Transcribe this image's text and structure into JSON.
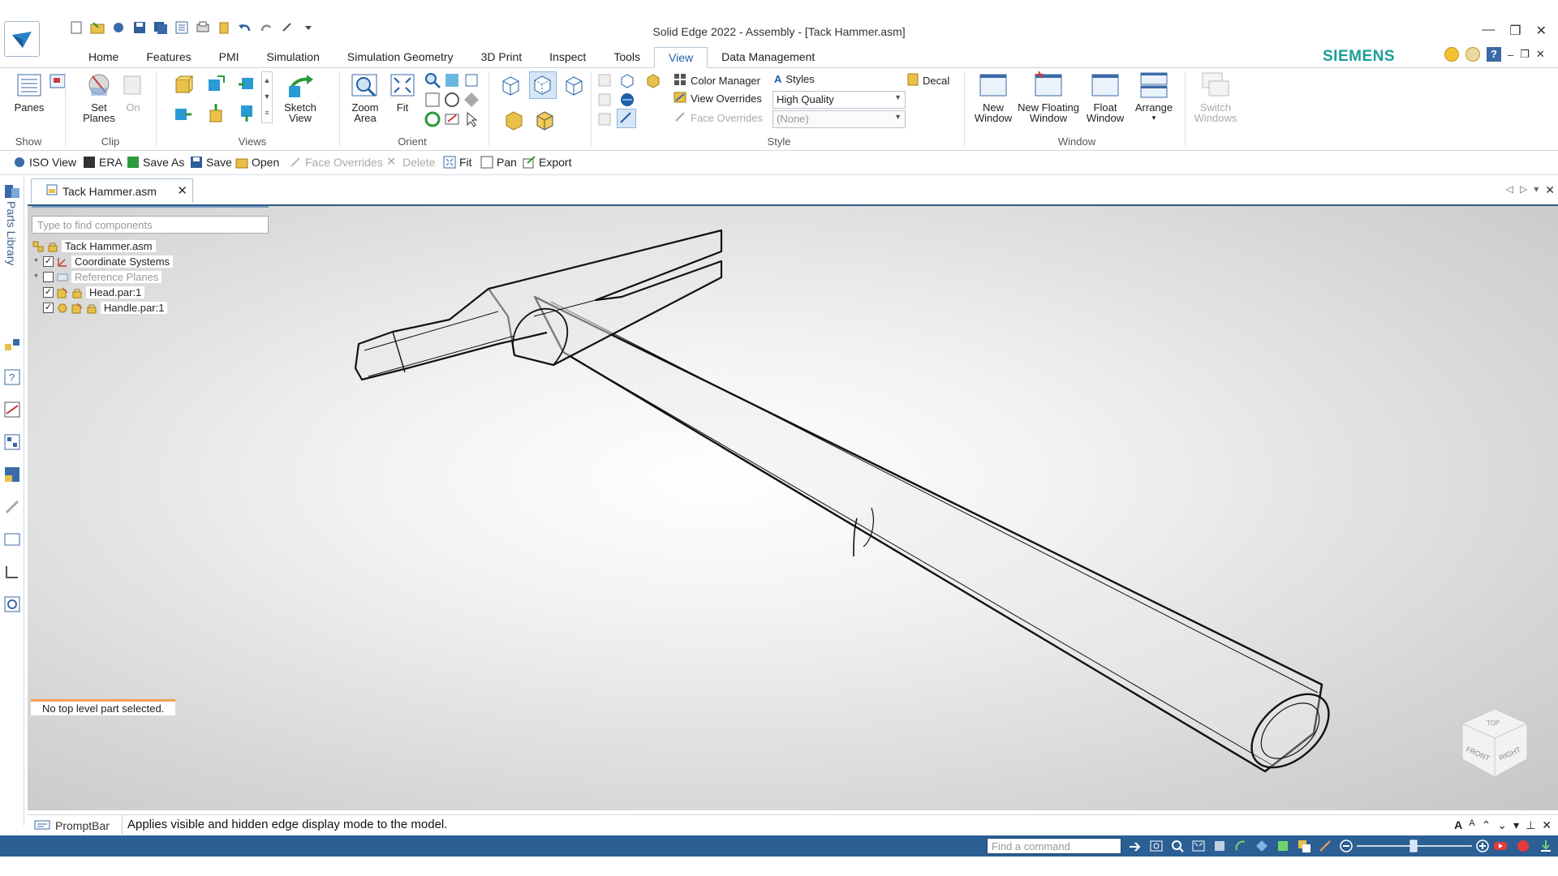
{
  "window": {
    "title": "Solid Edge 2022 - Assembly - [Tack Hammer.asm]",
    "brand": "SIEMENS",
    "brand_color": "#1a9e9a",
    "accent_color": "#2c5f94"
  },
  "tabs": [
    "Home",
    "Features",
    "PMI",
    "Simulation",
    "Simulation Geometry",
    "3D Print",
    "Inspect",
    "Tools",
    "View",
    "Data Management"
  ],
  "active_tab": "View",
  "ribbon": {
    "show": {
      "label": "Show",
      "panes": "Panes"
    },
    "clip": {
      "label": "Clip",
      "set_planes_1": "Set",
      "set_planes_2": "Planes",
      "on": "On"
    },
    "views": {
      "label": "Views",
      "sketch_view_1": "Sketch",
      "sketch_view_2": "View"
    },
    "orient": {
      "label": "Orient",
      "zoom_area_1": "Zoom",
      "zoom_area_2": "Area",
      "fit": "Fit"
    },
    "style": {
      "label": "Style",
      "color_manager": "Color Manager",
      "styles": "Styles",
      "decal": "Decal",
      "view_overrides": "View Overrides",
      "view_overrides_value": "High Quality",
      "face_overrides": "Face Overrides",
      "face_overrides_value": "(None)"
    },
    "window": {
      "label": "Window",
      "new_window_1": "New",
      "new_window_2": "Window",
      "new_floating_1": "New Floating",
      "new_floating_2": "Window",
      "float_window_1": "Float",
      "float_window_2": "Window",
      "arrange": "Arrange",
      "switch_windows_1": "Switch",
      "switch_windows_2": "Windows"
    }
  },
  "command_bar": {
    "iso_view": "ISO View",
    "era": "ERA",
    "save_as": "Save As",
    "save": "Save",
    "open": "Open",
    "face_overrides": "Face Overrides",
    "delete": "Delete",
    "fit": "Fit",
    "pan": "Pan",
    "export": "Export"
  },
  "document_tab": "Tack Hammer.asm",
  "left_rail_label": "Parts Library",
  "pathfinder": {
    "search_placeholder": "Type to find components",
    "items": [
      {
        "label": "Tack Hammer.asm",
        "checked": null
      },
      {
        "label": "Coordinate Systems",
        "checked": true
      },
      {
        "label": "Reference Planes",
        "checked": false
      },
      {
        "label": "Head.par:1",
        "checked": true
      },
      {
        "label": "Handle.par:1",
        "checked": true
      }
    ],
    "status": "No top level part selected."
  },
  "viewcube": {
    "front": "FRONT",
    "right": "RIGHT",
    "top": "TOP"
  },
  "prompt_bar": {
    "label": "PromptBar",
    "message": "Applies visible and hidden edge display mode to the model."
  },
  "status_bar": {
    "find_placeholder": "Find a command"
  }
}
